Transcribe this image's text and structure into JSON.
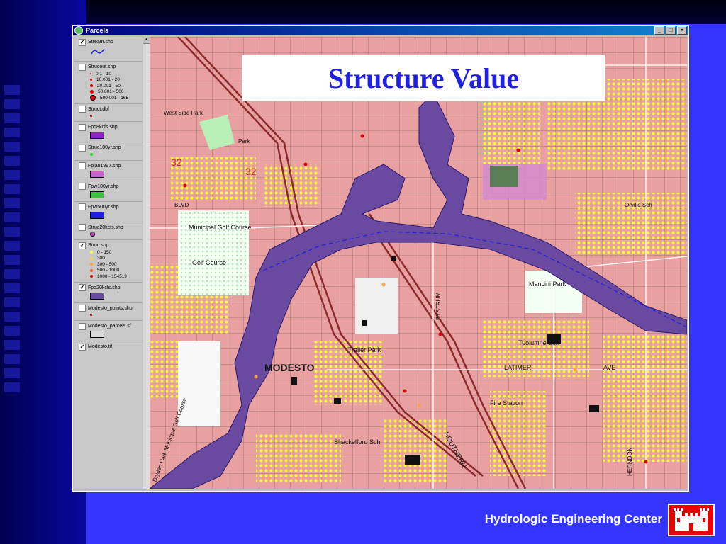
{
  "window": {
    "title": "Parcels",
    "controls": [
      "_",
      "□",
      "×"
    ]
  },
  "legend": {
    "layers": [
      {
        "name": "Stream.shp",
        "checked": true,
        "symbol": "stream-line"
      },
      {
        "name": "Strucout.shp",
        "checked": false,
        "classes": [
          "0.1 - 10",
          "10.001 - 20",
          "20.001 - 50",
          "50.001 - 500",
          "500.001 - 165"
        ]
      },
      {
        "name": "Struct.dbf",
        "checked": false,
        "symbol": "point"
      },
      {
        "name": "Fpq8kcfs.shp",
        "checked": false,
        "color": "#9020c0"
      },
      {
        "name": "Struc100yr.shp",
        "checked": false,
        "symbol": "point-green"
      },
      {
        "name": "Fpjan1997.shp",
        "checked": false,
        "color": "#d060d0"
      },
      {
        "name": "Fpw100yr.shp",
        "checked": false,
        "color": "#40c040"
      },
      {
        "name": "Fpw500yr.shp",
        "checked": false,
        "color": "#2020e0"
      },
      {
        "name": "Struc20kcfs.shp",
        "checked": false,
        "symbol": "point-purple"
      },
      {
        "name": "Struc.shp",
        "checked": true,
        "classes": [
          "0 - 150",
          "300",
          "300 - 500",
          "500 - 1000",
          "1000 - 154519"
        ]
      },
      {
        "name": "Fpq20kcfs.shp",
        "checked": true,
        "color": "#6a4aa0"
      },
      {
        "name": "Modesto_points.shp",
        "checked": false,
        "symbol": "point"
      },
      {
        "name": "Modesto_parcels.sf",
        "checked": false,
        "color": "#d8d8d8"
      },
      {
        "name": "Modesto.tif",
        "checked": true
      }
    ]
  },
  "map": {
    "labels": [
      "Municipal Golf Course",
      "Golf Course",
      "Mancini Park",
      "Tuolumne Sch",
      "Fire Station",
      "Trailer Park",
      "Shackelford Sch",
      "Dryden Park Municipal Golf Course",
      "West Side Park",
      "LATIMER",
      "AVE",
      "SOUTHERN",
      "BYSTRUM",
      "HERNDON",
      "Orville Sch",
      "BLVD",
      "Park",
      "32",
      "32",
      "MODESTO"
    ]
  },
  "slide": {
    "title": "Structure Value",
    "footer": "Hydrologic Engineering Center"
  },
  "colors": {
    "background": "#3434ff",
    "title": "#2020e0",
    "river": "#6a4aa0",
    "map_base": "#e8a0a0",
    "structure_points": "#ffff30",
    "logo": "#e60000"
  }
}
